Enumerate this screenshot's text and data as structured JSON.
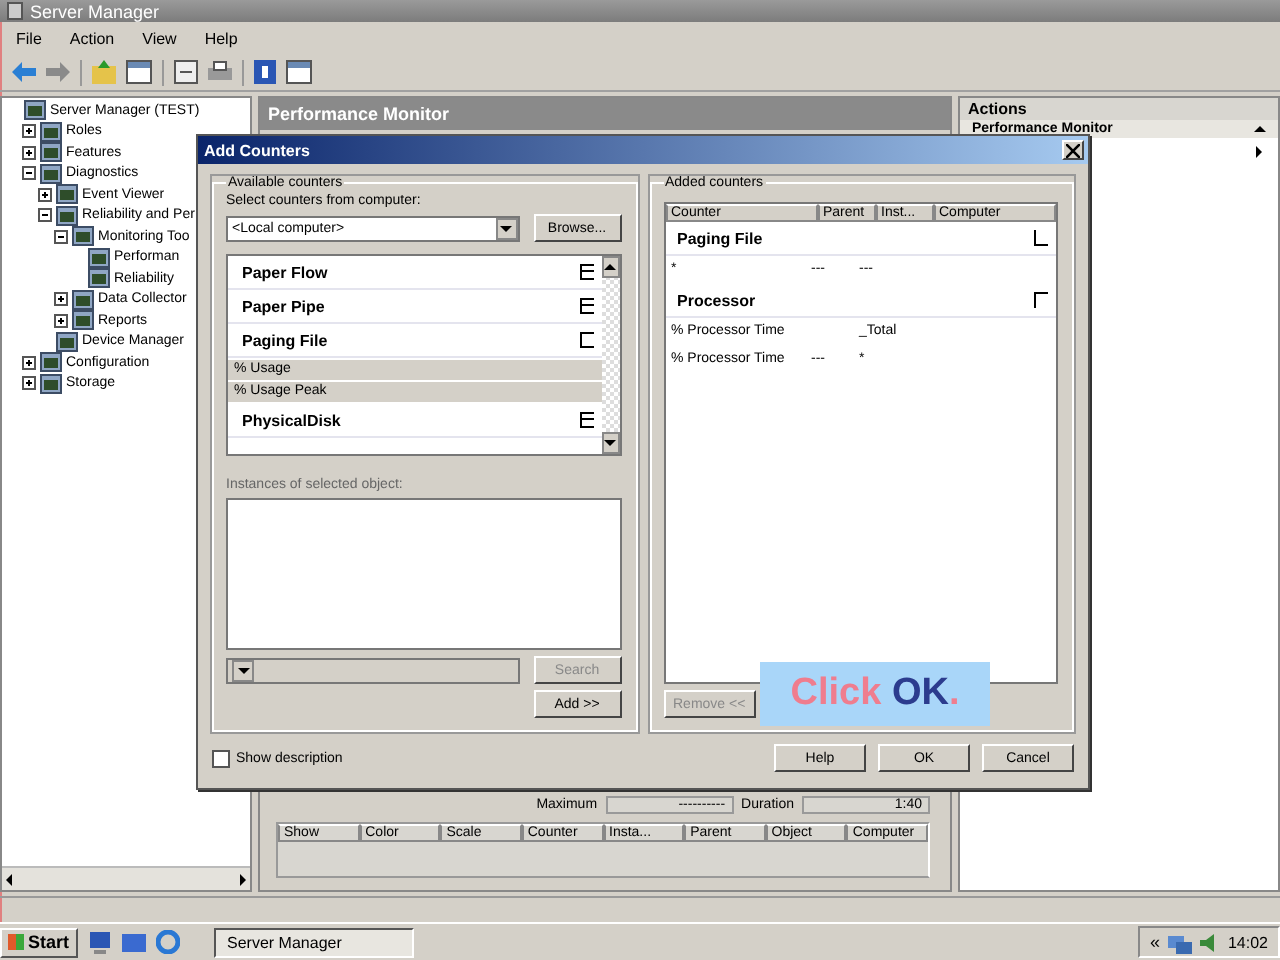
{
  "window": {
    "title": "Server Manager"
  },
  "menu": [
    "File",
    "Action",
    "View",
    "Help"
  ],
  "tree": [
    {
      "label": "Server Manager (TEST)",
      "children": [
        {
          "label": "Roles",
          "expanded": false
        },
        {
          "label": "Features",
          "expanded": false
        },
        {
          "label": "Diagnostics",
          "expanded": true,
          "children": [
            {
              "label": "Event Viewer",
              "expanded": false
            },
            {
              "label": "Reliability and Per",
              "expanded": true,
              "children": [
                {
                  "label": "Monitoring Too",
                  "expanded": true,
                  "children": [
                    {
                      "label": "Performan"
                    },
                    {
                      "label": "Reliability"
                    }
                  ]
                },
                {
                  "label": "Data Collector",
                  "expanded": false
                },
                {
                  "label": "Reports",
                  "expanded": false
                }
              ]
            },
            {
              "label": "Device Manager"
            }
          ]
        },
        {
          "label": "Configuration",
          "expanded": false
        },
        {
          "label": "Storage",
          "expanded": false
        }
      ]
    }
  ],
  "center": {
    "title": "Performance Monitor",
    "maximum_label": "Maximum",
    "maximum_value": "----------",
    "duration_label": "Duration",
    "duration_value": "1:40",
    "columns": [
      "Show",
      "Color",
      "Scale",
      "Counter",
      "Insta...",
      "Parent",
      "Object",
      "Computer"
    ]
  },
  "actions": {
    "title": "Actions",
    "item": "Performance Monitor"
  },
  "dialog": {
    "title": "Add Counters",
    "available": {
      "title": "Available counters",
      "computer_label": "Select counters from computer:",
      "computer": "<Local computer>",
      "browse": "Browse...",
      "items": [
        {
          "kind": "object",
          "label": "Paper Flow",
          "expanded": false
        },
        {
          "kind": "object",
          "label": "Paper Pipe",
          "expanded": false
        },
        {
          "kind": "object",
          "label": "Paging File",
          "expanded": true
        },
        {
          "kind": "counter",
          "label": "% Usage",
          "selected": true
        },
        {
          "kind": "counter",
          "label": "% Usage Peak",
          "selected": true
        },
        {
          "kind": "object",
          "label": "PhysicalDisk",
          "expanded": false
        }
      ],
      "instances_label": "Instances of selected object:",
      "search": "Search",
      "add": "Add >>"
    },
    "added": {
      "title": "Added counters",
      "columns": [
        "Counter",
        "Parent",
        "Inst...",
        "Computer"
      ],
      "rows": [
        {
          "kind": "group",
          "counter": "Paging File",
          "expanded": true
        },
        {
          "kind": "row",
          "counter": "*",
          "parent": "---",
          "instance": "---"
        },
        {
          "kind": "group",
          "counter": "Processor",
          "expanded": false
        },
        {
          "kind": "row",
          "counter": "% Processor Time",
          "parent": "",
          "instance": "_Total"
        },
        {
          "kind": "row",
          "counter": "% Processor Time",
          "parent": "---",
          "instance": "*"
        }
      ],
      "remove": "Remove <<"
    },
    "show_description": {
      "label": "Show description",
      "checked": false
    },
    "buttons": [
      "Help",
      "OK",
      "Cancel"
    ]
  },
  "callout": {
    "parts": [
      {
        "text": "Click ",
        "color": "#ef7d8e"
      },
      {
        "text": "OK",
        "color": "#2c3c8e"
      },
      {
        "text": ".",
        "color": "#ef7d8e"
      }
    ]
  },
  "taskbar": {
    "start": "Start",
    "task": "Server Manager",
    "tray": "«",
    "clock": "14:02"
  }
}
